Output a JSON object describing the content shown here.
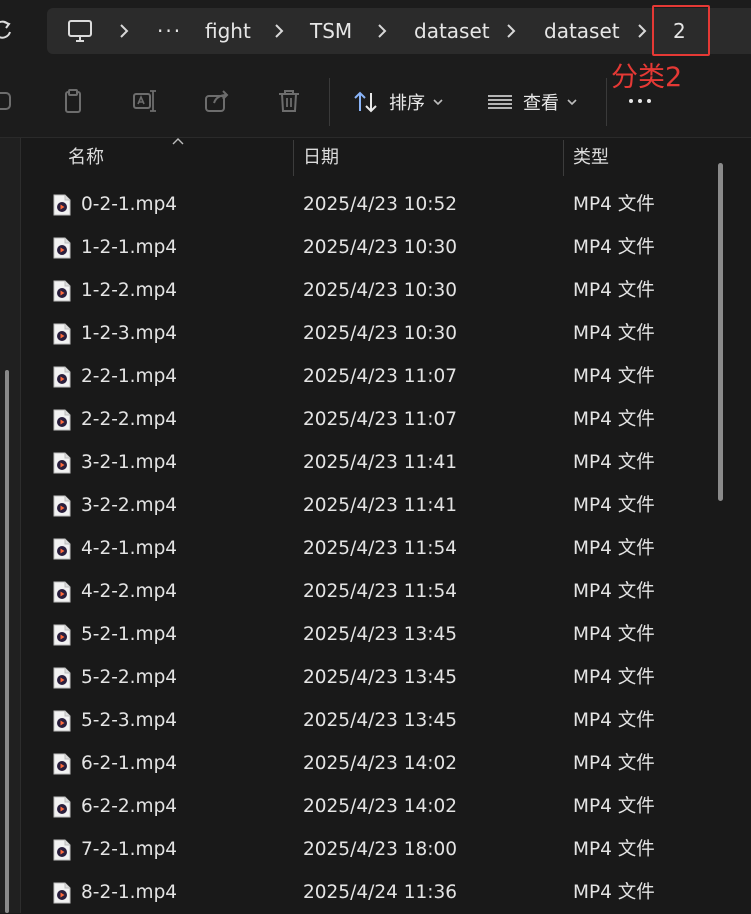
{
  "breadcrumb": {
    "items": [
      "fight",
      "TSM",
      "dataset",
      "dataset",
      "2"
    ],
    "overflow_label": "···"
  },
  "annotation": {
    "label": "分类2",
    "color": "#e53935"
  },
  "toolbar": {
    "sort_label": "排序",
    "view_label": "查看"
  },
  "columns": {
    "name": "名称",
    "date": "日期",
    "type": "类型"
  },
  "files": [
    {
      "name": "0-2-1.mp4",
      "date": "2025/4/23 10:52",
      "type": "MP4 文件"
    },
    {
      "name": "1-2-1.mp4",
      "date": "2025/4/23 10:30",
      "type": "MP4 文件"
    },
    {
      "name": "1-2-2.mp4",
      "date": "2025/4/23 10:30",
      "type": "MP4 文件"
    },
    {
      "name": "1-2-3.mp4",
      "date": "2025/4/23 10:30",
      "type": "MP4 文件"
    },
    {
      "name": "2-2-1.mp4",
      "date": "2025/4/23 11:07",
      "type": "MP4 文件"
    },
    {
      "name": "2-2-2.mp4",
      "date": "2025/4/23 11:07",
      "type": "MP4 文件"
    },
    {
      "name": "3-2-1.mp4",
      "date": "2025/4/23 11:41",
      "type": "MP4 文件"
    },
    {
      "name": "3-2-2.mp4",
      "date": "2025/4/23 11:41",
      "type": "MP4 文件"
    },
    {
      "name": "4-2-1.mp4",
      "date": "2025/4/23 11:54",
      "type": "MP4 文件"
    },
    {
      "name": "4-2-2.mp4",
      "date": "2025/4/23 11:54",
      "type": "MP4 文件"
    },
    {
      "name": "5-2-1.mp4",
      "date": "2025/4/23 13:45",
      "type": "MP4 文件"
    },
    {
      "name": "5-2-2.mp4",
      "date": "2025/4/23 13:45",
      "type": "MP4 文件"
    },
    {
      "name": "5-2-3.mp4",
      "date": "2025/4/23 13:45",
      "type": "MP4 文件"
    },
    {
      "name": "6-2-1.mp4",
      "date": "2025/4/23 14:02",
      "type": "MP4 文件"
    },
    {
      "name": "6-2-2.mp4",
      "date": "2025/4/23 14:02",
      "type": "MP4 文件"
    },
    {
      "name": "7-2-1.mp4",
      "date": "2025/4/23 18:00",
      "type": "MP4 文件"
    },
    {
      "name": "8-2-1.mp4",
      "date": "2025/4/24 11:36",
      "type": "MP4 文件"
    }
  ],
  "icons": {
    "refresh": "refresh-icon",
    "this_pc": "monitor-icon",
    "separator": "chevron-right-icon",
    "copy": "copy-icon",
    "rename": "rename-icon",
    "share": "share-icon",
    "delete": "trash-icon",
    "sort": "sort-icon",
    "view": "view-lines-icon",
    "more": "more-dots-icon",
    "file": "video-file-icon"
  }
}
